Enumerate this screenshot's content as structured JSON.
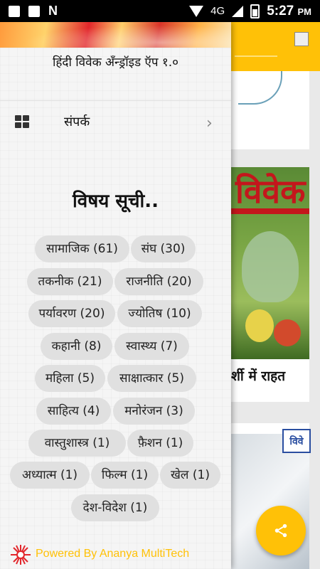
{
  "status_bar": {
    "network": "4G",
    "time": "5:27",
    "ampm": "PM"
  },
  "drawer": {
    "version_text": "हिंदी विवेक अँन्ड्रॉइड ऍप १.०",
    "menu": {
      "contact_label": "संपर्क"
    },
    "topics_title": "विषय सूची..",
    "tags": [
      "सामाजिक (61)",
      "संघ (30)",
      "तकनीक (21)",
      "राजनीति (20)",
      "पर्यावरण (20)",
      "ज्योतिष (10)",
      "कहानी (8)",
      "स्वास्थ्य (7)",
      "महिला (5)",
      "साक्षात्कार (5)",
      "साहित्य (4)",
      "मनोरंजन (3)",
      "वास्तुशास्त्र (1)",
      "फ़ैशन (1)",
      "अध्यात्म (1)",
      "फिल्म (1)",
      "खेल (1)",
      "देश-विदेश (1)"
    ],
    "footer_text": "Powered By Ananya MultiTech"
  },
  "background": {
    "magazine_title": "विवेक",
    "magazine_caption": "र्शी में राहत",
    "mini_logo": "विवे"
  },
  "colors": {
    "accent": "#ffc107",
    "tag_bg": "#e0e0e0"
  },
  "icons": [
    "message-icon",
    "image-icon",
    "n-icon",
    "wifi-icon",
    "signal-icon",
    "battery-icon",
    "grid-icon",
    "chevron-right-icon",
    "share-icon",
    "company-logo-icon"
  ]
}
